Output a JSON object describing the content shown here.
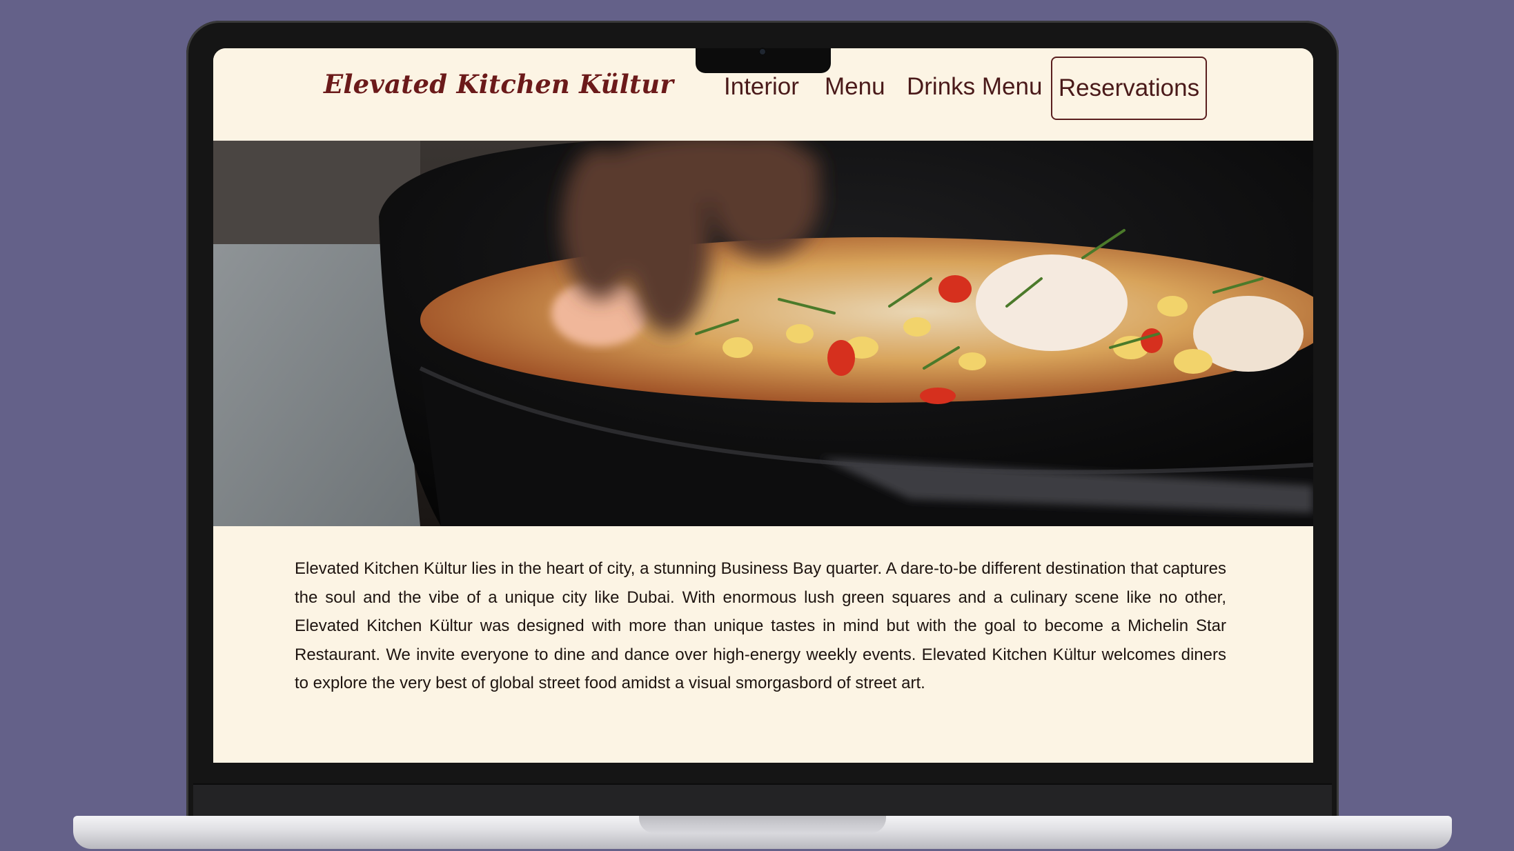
{
  "site": {
    "brand": "Elevated Kitchen Kültur",
    "nav": [
      {
        "label": "Interior"
      },
      {
        "label": "Menu"
      },
      {
        "label": "Drinks Menu"
      }
    ],
    "cta_label": "Reservations"
  },
  "hero": {
    "image_alt": "Seafood pasta in a black pan being garnished"
  },
  "intro": {
    "text": "Elevated Kitchen Kültur lies in the heart of city, a stunning Business Bay quarter. A dare-to-be different destination that captures the soul and the vibe of a unique city like Dubai. With enormous lush green squares and a culinary scene like no other, Elevated Kitchen Kültur was designed with more than unique tastes in mind but with the goal to become a Michelin Star Restaurant. We invite everyone to dine and dance over high-energy weekly events. Elevated Kitchen Kültur welcomes diners to explore the very best of global street food amidst a visual smorgasbord of street art."
  },
  "colors": {
    "background": "#646189",
    "page": "#fcf4e4",
    "brand": "#6b1a1a",
    "nav_text": "#4a1a1a"
  }
}
